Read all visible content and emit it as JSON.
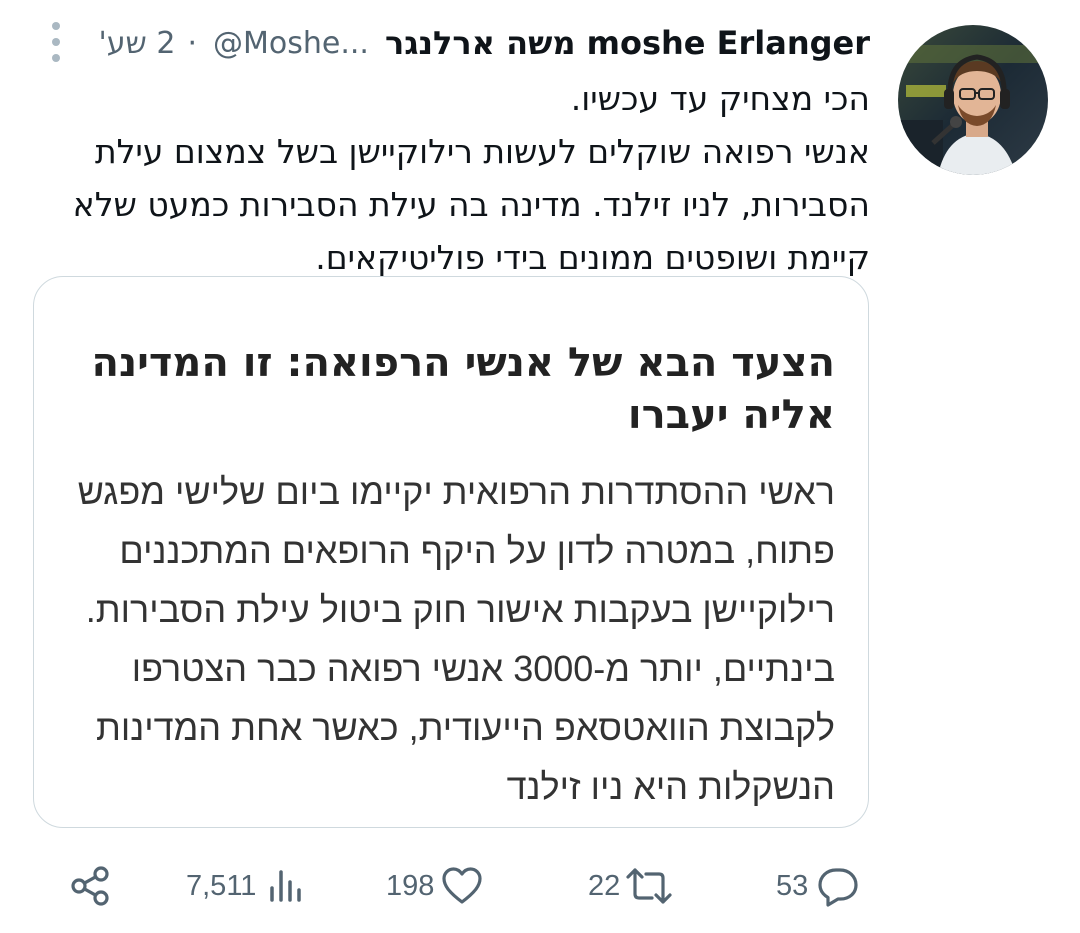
{
  "author": {
    "display_name": "moshe Erlanger משה ארלנגר",
    "handle": "@Moshe...",
    "separator": "·",
    "time": "2 שע'"
  },
  "tweet": {
    "lines": [
      "הכי מצחיק עד עכשיו.",
      "אנשי רפואה שוקלים לעשות  רילוקיישן בשל צמצום עילת",
      "הסבירות, לניו זילנד. מדינה בה עילת הסבירות כמעט שלא",
      "קיימת ושופטים ממונים בידי פוליטיקאים."
    ]
  },
  "card": {
    "title_lines": [
      "הצעד הבא של אנשי הרפואה: זו המדינה",
      "אליה יעברו"
    ],
    "body_lines": [
      "ראשי ההסתדרות הרפואית יקיימו ביום שלישי מפגש",
      "פתוח, במטרה לדון על היקף הרופאים המתכננים",
      "רילוקיישן בעקבות אישור חוק ביטול עילת הסבירות.",
      "בינתיים, יותר מ-3000 אנשי רפואה כבר הצטרפו",
      "לקבוצת הוואטסאפ הייעודית, כאשר אחת המדינות",
      "הנשקלות היא ניו זילנד"
    ]
  },
  "actions": {
    "replies": "53",
    "reposts": "22",
    "likes": "198",
    "views": "7,511"
  },
  "icons": {
    "more": "more-vertical-icon",
    "reply": "reply-bubble-icon",
    "repost": "repost-icon",
    "like": "heart-icon",
    "views": "bar-chart-icon",
    "share": "share-icon"
  },
  "colors": {
    "text": "#0f1419",
    "secondary": "#536471",
    "border": "#cfd9de",
    "more_dots": "#aab8c2"
  }
}
